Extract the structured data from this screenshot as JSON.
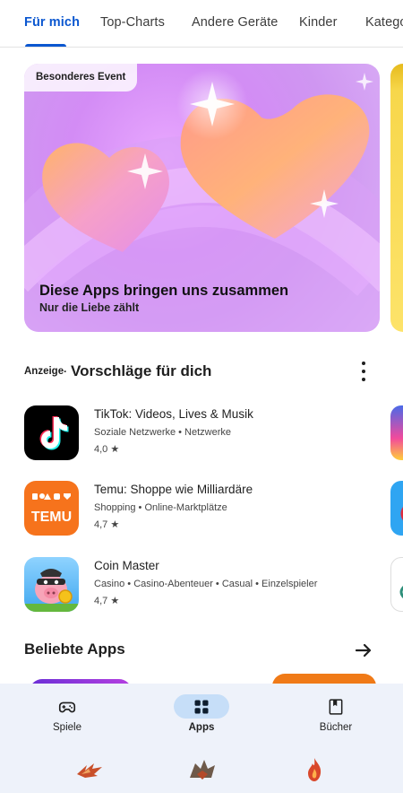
{
  "tabs": [
    {
      "label": "Für mich",
      "active": true
    },
    {
      "label": "Top-Charts"
    },
    {
      "label": "Andere Geräte"
    },
    {
      "label": "Kinder"
    },
    {
      "label": "Kategorien"
    }
  ],
  "event": {
    "badge": "Besonderes Event",
    "title": "Diese Apps bringen uns zusammen",
    "subtitle": "Nur die Liebe zählt"
  },
  "suggestions": {
    "ad_label": "Anzeige",
    "title": "Vorschläge für dich",
    "apps": [
      {
        "name": "TikTok: Videos, Lives & Musik",
        "categories": "Soziale Netzwerke • Netzwerke",
        "rating": "4,0 ★",
        "icon": "tiktok-icon"
      },
      {
        "name": "Temu: Shoppe wie Milliardäre",
        "categories": "Shopping • Online-Marktplätze",
        "rating": "4,7 ★",
        "icon": "temu-icon",
        "icon_text": "TEMU"
      },
      {
        "name": "Coin Master",
        "categories": "Casino • Casino-Abenteuer • Casual • Einzelspieler",
        "rating": "4,7 ★",
        "icon": "coin-master-icon"
      }
    ]
  },
  "popular": {
    "title": "Beliebte Apps"
  },
  "bottom_nav": [
    {
      "label": "Spiele",
      "icon": "gamepad-icon"
    },
    {
      "label": "Apps",
      "icon": "apps-grid-icon",
      "active": true
    },
    {
      "label": "Bücher",
      "icon": "bookmark-book-icon"
    }
  ],
  "colors": {
    "accent": "#0b57d0",
    "nav_background": "#eef2fa",
    "nav_active_pill": "#c6def8",
    "temu_orange": "#f6731c",
    "tiktok_black": "#000000"
  }
}
